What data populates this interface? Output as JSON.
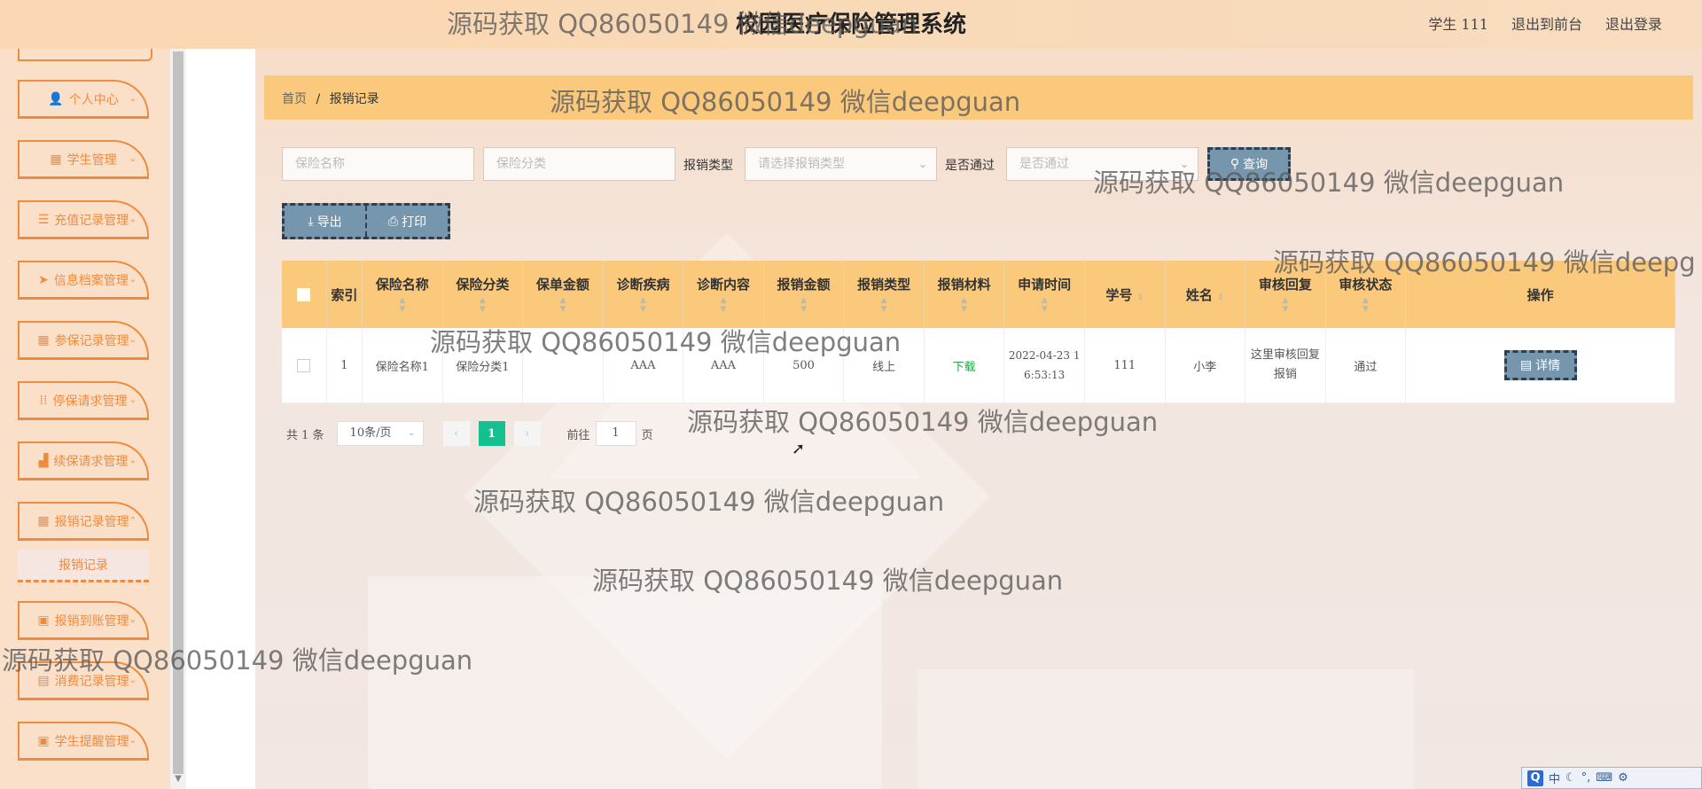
{
  "app": {
    "title": "校园医疗保险管理系统"
  },
  "top_nav": {
    "user": "学生 111",
    "front": "退出到前台",
    "logout": "退出登录"
  },
  "sidebar": {
    "items": [
      {
        "label": "个人中心",
        "icon": "user-icon"
      },
      {
        "label": "学生管理",
        "icon": "grid-icon"
      },
      {
        "label": "充值记录管理",
        "icon": "list-icon"
      },
      {
        "label": "信息档案管理",
        "icon": "send-icon"
      },
      {
        "label": "参保记录管理",
        "icon": "grid-icon"
      },
      {
        "label": "停保请求管理",
        "icon": "grid-dots-icon"
      },
      {
        "label": "续保请求管理",
        "icon": "thumb-icon"
      },
      {
        "label": "报销记录管理",
        "icon": "grid-icon"
      },
      {
        "label": "报销到账管理",
        "icon": "clipboard-icon"
      },
      {
        "label": "消费记录管理",
        "icon": "ticket-icon"
      },
      {
        "label": "学生提醒管理",
        "icon": "clipboard-icon"
      }
    ],
    "active_submenu": "报销记录"
  },
  "breadcrumb": {
    "home": "首页",
    "sep": "/",
    "current": "报销记录"
  },
  "filters": {
    "insurance_name_placeholder": "保险名称",
    "insurance_category_placeholder": "保险分类",
    "reimburse_type_label": "报销类型",
    "reimburse_type_placeholder": "请选择报销类型",
    "approved_label": "是否通过",
    "approved_placeholder": "是否通过",
    "query_label": "查询"
  },
  "actions": {
    "export_label": "导出",
    "print_label": "打印"
  },
  "table": {
    "columns": [
      "索引",
      "保险名称",
      "保险分类",
      "保单金额",
      "诊断疾病",
      "诊断内容",
      "报销金额",
      "报销类型",
      "报销材料",
      "申请时间",
      "学号",
      "姓名",
      "审核回复",
      "审核状态",
      "操作"
    ],
    "rows": [
      {
        "index": "1",
        "insurance_name": "保险名称1",
        "insurance_category": "保险分类1",
        "policy_amount": "",
        "disease": "AAA",
        "diagnosis": "AAA",
        "reimburse_amount": "500",
        "reimburse_type": "线上",
        "material": "下载",
        "apply_time": "2022-04-23 16:53:13",
        "student_no": "111",
        "name": "小李",
        "reply": "这里审核回复报销",
        "status": "通过",
        "action": "详情"
      }
    ]
  },
  "pagination": {
    "total": "共 1 条",
    "page_size": "10条/页",
    "current_page": "1",
    "goto_label": "前往",
    "goto_value": "1",
    "page_unit": "页"
  },
  "watermark": "源码获取 QQ86050149 微信deepguan",
  "watermark_cut": "源码获取 QQ86050149 微信deepg",
  "ime": {
    "lang": "中"
  }
}
